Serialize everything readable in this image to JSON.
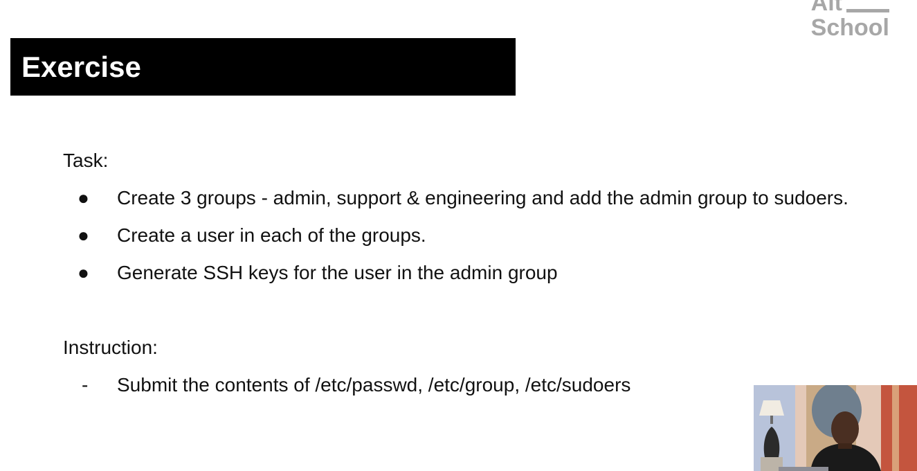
{
  "logo": {
    "line1": "Alt",
    "line2": "School"
  },
  "slide": {
    "title": "Exercise",
    "task_heading": "Task:",
    "tasks": [
      "Create 3 groups - admin, support & engineering and add the admin group to sudoers.",
      "Create a user in each of the groups.",
      "Generate SSH keys for the user in the admin group"
    ],
    "bullet_char": "●",
    "instruction_heading": "Instruction:",
    "instructions": [
      "Submit the contents of /etc/passwd, /etc/group, /etc/sudoers"
    ],
    "dash_char": "-"
  },
  "colors": {
    "title_bg": "#000000",
    "title_text": "#ffffff",
    "logo": "#a7a7a7",
    "body_text": "#111111"
  }
}
